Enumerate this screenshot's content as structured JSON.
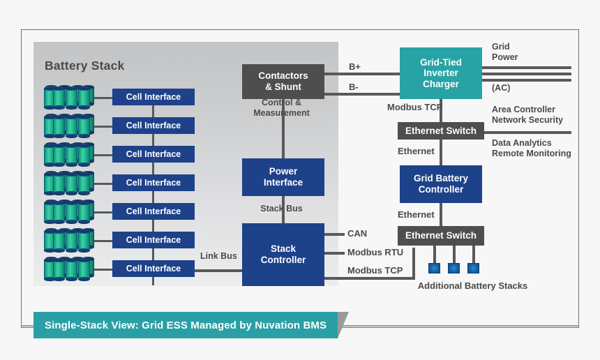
{
  "diagram": {
    "caption": "Single-Stack View: Grid ESS Managed by Nuvation BMS",
    "panel_title": "Battery Stack",
    "colors": {
      "blue": "#1d428a",
      "teal": "#28a3a5",
      "dark_gray": "#4e4e4e",
      "line": "#58595b",
      "panel_gray_top": "#c2c4c6",
      "panel_gray_bottom": "#eceded",
      "battery_green": "#23b98f",
      "text_gray": "#4a4a4a"
    }
  },
  "cell_interfaces": [
    {
      "label": "Cell Interface"
    },
    {
      "label": "Cell Interface"
    },
    {
      "label": "Cell Interface"
    },
    {
      "label": "Cell Interface"
    },
    {
      "label": "Cell Interface"
    },
    {
      "label": "Cell Interface"
    },
    {
      "label": "Cell Interface"
    }
  ],
  "blocks": {
    "contactors_shunt": "Contactors\n& Shunt",
    "power_interface": "Power\nInterface",
    "stack_controller": "Stack\nController",
    "grid_tied_inverter": "Grid-Tied\nInverter\nCharger",
    "ethernet_switch_top": "Ethernet Switch",
    "grid_battery_controller": "Grid Battery\nController",
    "ethernet_switch_bottom": "Ethernet Switch"
  },
  "bus_labels": {
    "control_measurement": "Control &\nMeasurement",
    "stack_bus": "Stack Bus",
    "link_bus": "Link Bus",
    "b_plus": "B+",
    "b_minus": "B-",
    "can": "CAN",
    "modbus_rtu": "Modbus RTU",
    "modbus_tcp_stack": "Modbus TCP",
    "modbus_tcp_inverter": "Modbus TCP",
    "ethernet_upper": "Ethernet",
    "ethernet_lower": "Ethernet",
    "grid_power": "Grid\nPower",
    "grid_power_ac": "(AC)",
    "area_controller": "Area Controller\nNetwork Security",
    "data_analytics": "Data Analytics\nRemote Monitoring",
    "additional_stacks": "Additional Battery Stacks"
  },
  "additional_stack_nodes": [
    {
      "name": "stack-node-1"
    },
    {
      "name": "stack-node-2"
    },
    {
      "name": "stack-node-3"
    }
  ]
}
